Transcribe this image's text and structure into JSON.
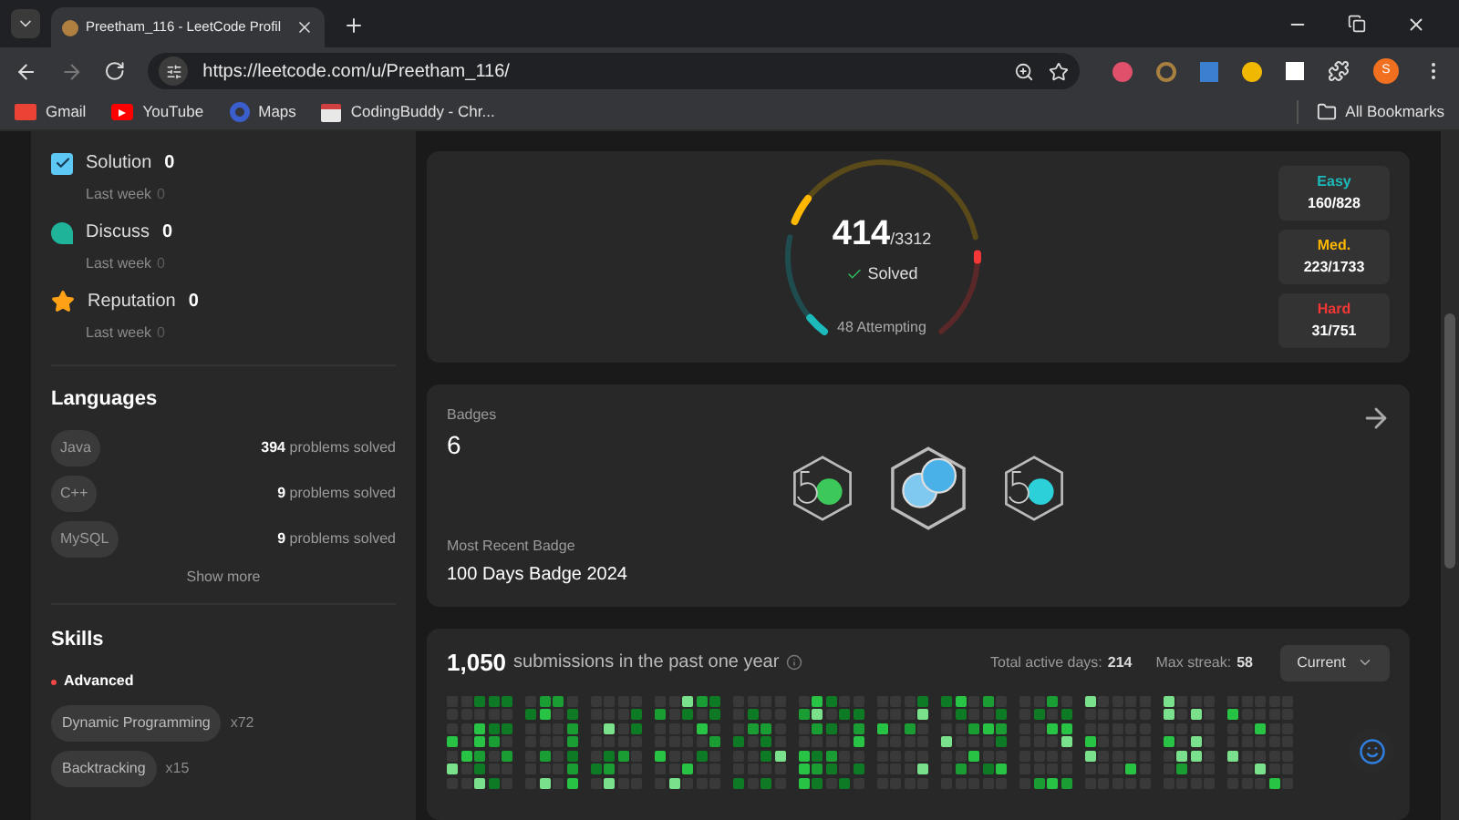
{
  "browser": {
    "tab_title": "Preetham_116 - LeetCode Profil",
    "url": "https://leetcode.com/u/Preetham_116/",
    "bookmarks": [
      {
        "kind": "gmail",
        "label": "Gmail"
      },
      {
        "kind": "youtube",
        "label": "YouTube"
      },
      {
        "kind": "maps",
        "label": "Maps"
      },
      {
        "kind": "page",
        "label": "CodingBuddy - Chr..."
      }
    ],
    "all_bookmarks": "All Bookmarks",
    "avatar": "S"
  },
  "community_stats": [
    {
      "kind": "solution",
      "label": "Solution",
      "value": "0",
      "last_week_label": "Last week",
      "last_week_value": "0"
    },
    {
      "kind": "discuss",
      "label": "Discuss",
      "value": "0",
      "last_week_label": "Last week",
      "last_week_value": "0"
    },
    {
      "kind": "reputation",
      "label": "Reputation",
      "value": "0",
      "last_week_label": "Last week",
      "last_week_value": "0"
    }
  ],
  "languages": {
    "title": "Languages",
    "items": [
      {
        "name": "Java",
        "count": "394",
        "suffix": "problems solved"
      },
      {
        "name": "C++",
        "count": "9",
        "suffix": "problems solved"
      },
      {
        "name": "MySQL",
        "count": "9",
        "suffix": "problems solved"
      }
    ],
    "show_more": "Show more"
  },
  "skills": {
    "title": "Skills",
    "levels": [
      {
        "label": "Advanced",
        "tags": [
          {
            "name": "Dynamic Programming",
            "count": "x72"
          },
          {
            "name": "Backtracking",
            "count": "x15"
          }
        ]
      }
    ]
  },
  "solved": {
    "solved": "414",
    "total": "/3312",
    "label": "Solved",
    "attempting": "48 Attempting",
    "difficulties": [
      {
        "label": "Easy",
        "value": "160/828",
        "color": "#1cbaba"
      },
      {
        "label": "Med.",
        "value": "223/1733",
        "color": "#ffb700"
      },
      {
        "label": "Hard",
        "value": "31/751",
        "color": "#f63737"
      }
    ]
  },
  "badges": {
    "label": "Badges",
    "count": "6",
    "recent_label": "Most Recent Badge",
    "recent_name": "100 Days Badge 2024"
  },
  "submissions": {
    "count": "1,050",
    "text": "submissions in the past one year",
    "active_label": "Total active days:",
    "active_value": "214",
    "streak_label": "Max streak:",
    "streak_value": "58",
    "dropdown": "Current"
  }
}
